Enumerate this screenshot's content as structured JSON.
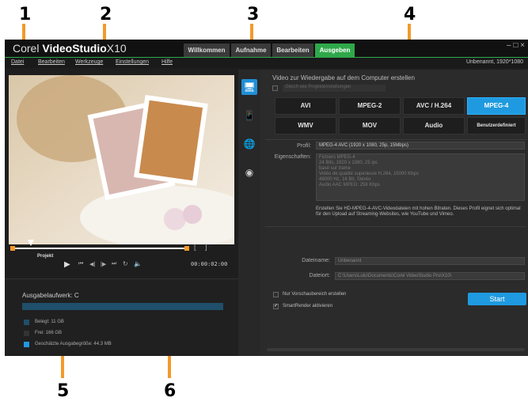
{
  "callouts": [
    "1",
    "2",
    "3",
    "4",
    "5",
    "6"
  ],
  "app": {
    "logo_brand": "Corel",
    "logo_product": "VideoStudio",
    "logo_version": "X10",
    "tabs": [
      "Willkommen",
      "Aufnahme",
      "Bearbeiten",
      "Ausgeben"
    ],
    "active_tab": "Ausgeben",
    "window_controls": "– □ ×",
    "menu": [
      "Datei",
      "Bearbeiten",
      "Werkzeuge",
      "Einstellungen",
      "Hilfe"
    ],
    "project_info": "Unbenannt, 1920*1080"
  },
  "player": {
    "project_label": "Projekt",
    "timecode": "00:00:02:00",
    "mark_in": "[",
    "mark_out": "]"
  },
  "output_drive": {
    "title": "Ausgabelaufwerk: C",
    "used": "Belegt: 11 GB",
    "free": "Frei: 166 GB",
    "estimated": "Geschätzte Ausgabegröße: 44.3 MB",
    "used_color": "#1f4f6a",
    "free_color": "#333333",
    "estimated_color": "#1f9ae0",
    "bar_color": "#1f4f6a"
  },
  "sidebar_icons": [
    "monitor-icon",
    "device-icon",
    "globe-icon",
    "disc-icon"
  ],
  "output": {
    "heading": "Video zur Wiedergabe auf dem Computer erstellen",
    "same_as_project": "Gleich wie Projekteinstellungen",
    "formats_row1": [
      "AVI",
      "MPEG-2",
      "AVC / H.264",
      "MPEG-4"
    ],
    "formats_row2": [
      "WMV",
      "MOV",
      "Audio",
      "Benutzerdefiniert"
    ],
    "active_format": "MPEG-4",
    "profile_label": "Profil:",
    "profile_value": "MPEG-4 AVC (1920 x 1080, 25p, 15Mbps)",
    "properties_label": "Eigenschaften:",
    "properties_lines": [
      "Fichiers MPEG-4",
      "24 Bits, 1920 x 1080, 25 ips",
      "basé sur trame",
      "Vidéo de qualité supérieure H.264, 15000 Kbps",
      "48000 Hz, 16 Bit, Stéréo",
      "Audio AAC MPEG: 256 Kbps"
    ],
    "description": "Erstellen Sie HD-MPEG-4-AVC-Videodateien mit hohen Bitraten. Dieses Profil eignet sich optimal für den Upload auf Streaming-Websites, wie YouTube und Vimeo.",
    "filename_label": "Dateiname:",
    "filename_value": "Unbenannt",
    "location_label": "Dateiort:",
    "location_value": "C:\\Users\\Lulu\\Documents\\Corel VideoStudio Pro\\X10\\",
    "preview_only": "Nur Vorschaubereich erstellen",
    "smartrender": "SmartRender aktivieren",
    "start": "Start"
  }
}
